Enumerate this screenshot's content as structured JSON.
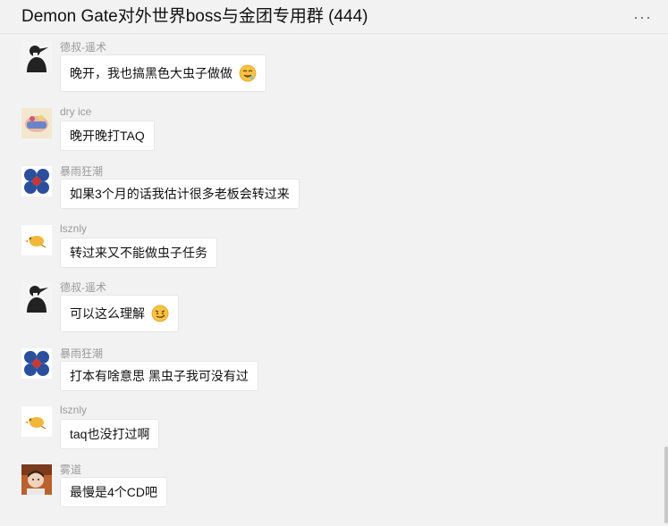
{
  "header": {
    "title": "Demon Gate对外世界boss与金团专用群 (444)",
    "more_glyph": "···"
  },
  "messages": [
    {
      "sender": "德叔-遥术",
      "text": "晚开，我也搞黑色大虫子做做",
      "avatar": "ink-portrait-avatar",
      "emoji": "drooling-face-emoji"
    },
    {
      "sender": "dry ice",
      "text": "晚开晚打TAQ",
      "avatar": "cartoon-avatar"
    },
    {
      "sender": "暴雨狂潮",
      "text": "如果3个月的话我估计很多老板会转过来",
      "avatar": "blue-emblem-avatar"
    },
    {
      "sender": "lsznly",
      "text": "转过来又不能做虫子任务",
      "avatar": "yellow-bird-avatar"
    },
    {
      "sender": "德叔-遥术",
      "text": "可以这么理解",
      "avatar": "ink-portrait-avatar",
      "emoji": "smirk-face-emoji"
    },
    {
      "sender": "暴雨狂潮",
      "text": "打本有啥意思 黑虫子我可没有过",
      "avatar": "blue-emblem-avatar"
    },
    {
      "sender": "lsznly",
      "text": "taq也没打过啊",
      "avatar": "yellow-bird-avatar"
    },
    {
      "sender": "雾道",
      "text": "最慢是4个CD吧",
      "avatar": "child-photo-avatar"
    }
  ]
}
